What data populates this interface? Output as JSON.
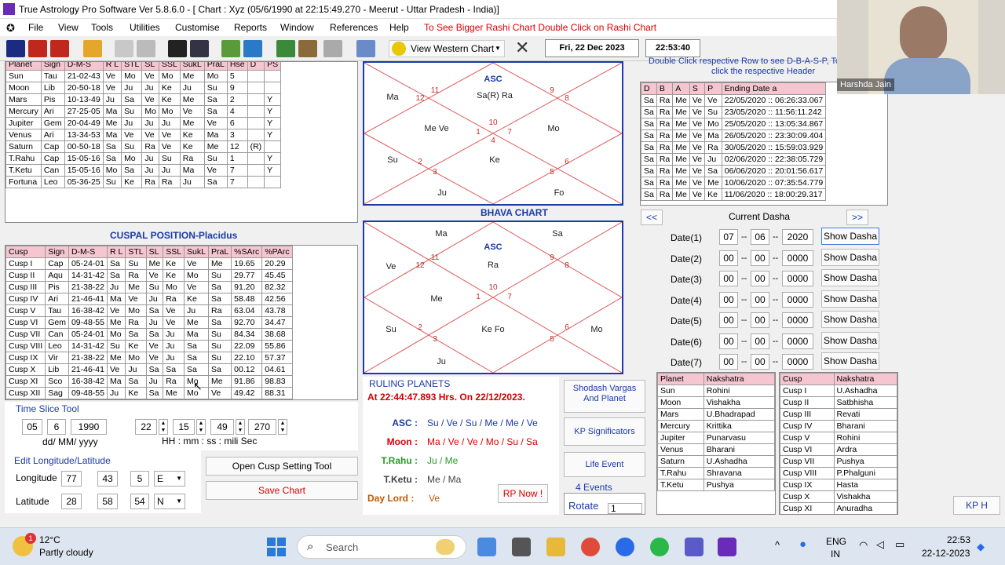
{
  "title_bar": {
    "title": "True Astrology Pro Software Ver 5.8.6.0 - [ Chart : Xyz (05/6/1990 at 22:15:49.270 - Meerut - Uttar Pradesh - India)]"
  },
  "menu": {
    "items": [
      "File",
      "View",
      "Tools",
      "Utilities",
      "Customise",
      "Reports",
      "Window",
      "References",
      "Help"
    ],
    "hint": "To See Bigger Rashi Chart Double Click on Rashi Chart"
  },
  "toolbar": {
    "view_western": "View Western Chart",
    "date": "Fri, 22 Dec 2023",
    "time": "22:53:40"
  },
  "planet_table": {
    "headers": [
      "Planet",
      "Sign",
      "D-M-S",
      "R L",
      "STL",
      "SL",
      "SSL",
      "SukL",
      "PraL",
      "Hse",
      "D",
      "PS"
    ],
    "rows": [
      [
        "Sun",
        "Tau",
        "21-02-43",
        "Ve",
        "Mo",
        "Ve",
        "Mo",
        "Me",
        "Mo",
        "5",
        "",
        ""
      ],
      [
        "Moon",
        "Lib",
        "20-50-18",
        "Ve",
        "Ju",
        "Ju",
        "Ke",
        "Ju",
        "Su",
        "9",
        "",
        ""
      ],
      [
        "Mars",
        "Pis",
        "10-13-49",
        "Ju",
        "Sa",
        "Ve",
        "Ke",
        "Me",
        "Sa",
        "2",
        "",
        "Y"
      ],
      [
        "Mercury",
        "Ari",
        "27-25-05",
        "Ma",
        "Su",
        "Mo",
        "Mo",
        "Ve",
        "Sa",
        "4",
        "",
        "Y"
      ],
      [
        "Jupiter",
        "Gem",
        "20-04-49",
        "Me",
        "Ju",
        "Ju",
        "Ju",
        "Me",
        "Ve",
        "6",
        "",
        "Y"
      ],
      [
        "Venus",
        "Ari",
        "13-34-53",
        "Ma",
        "Ve",
        "Ve",
        "Ve",
        "Ke",
        "Ma",
        "3",
        "",
        "Y"
      ],
      [
        "Saturn",
        "Cap",
        "00-50-18",
        "Sa",
        "Su",
        "Ra",
        "Ve",
        "Ke",
        "Me",
        "12",
        "(R)",
        ""
      ],
      [
        "T.Rahu",
        "Cap",
        "15-05-16",
        "Sa",
        "Mo",
        "Ju",
        "Su",
        "Ra",
        "Su",
        "1",
        "",
        "Y"
      ],
      [
        "T.Ketu",
        "Can",
        "15-05-16",
        "Mo",
        "Sa",
        "Ju",
        "Ju",
        "Ma",
        "Ve",
        "7",
        "",
        "Y"
      ],
      [
        "Fortuna",
        "Leo",
        "05-36-25",
        "Su",
        "Ke",
        "Ra",
        "Ra",
        "Ju",
        "Sa",
        "7",
        "",
        ""
      ]
    ]
  },
  "cuspal": {
    "title": "CUSPAL POSITION-Placidus",
    "headers": [
      "Cusp",
      "Sign",
      "D-M-S",
      "R L",
      "STL",
      "SL",
      "SSL",
      "SukL",
      "PraL",
      "%SArc",
      "%PArc"
    ],
    "rows": [
      [
        "Cusp I",
        "Cap",
        "05-24-01",
        "Sa",
        "Su",
        "Me",
        "Ke",
        "Ve",
        "Me",
        "19.65",
        "20.29"
      ],
      [
        "Cusp II",
        "Aqu",
        "14-31-42",
        "Sa",
        "Ra",
        "Ve",
        "Ke",
        "Mo",
        "Su",
        "29.77",
        "45.45"
      ],
      [
        "Cusp III",
        "Pis",
        "21-38-22",
        "Ju",
        "Me",
        "Su",
        "Mo",
        "Ve",
        "Sa",
        "91.20",
        "82.32"
      ],
      [
        "Cusp IV",
        "Ari",
        "21-46-41",
        "Ma",
        "Ve",
        "Ju",
        "Ra",
        "Ke",
        "Sa",
        "58.48",
        "42.56"
      ],
      [
        "Cusp V",
        "Tau",
        "16-38-42",
        "Ve",
        "Mo",
        "Sa",
        "Ve",
        "Ju",
        "Ra",
        "63.04",
        "43.78"
      ],
      [
        "Cusp VI",
        "Gem",
        "09-48-55",
        "Me",
        "Ra",
        "Ju",
        "Ve",
        "Me",
        "Sa",
        "92.70",
        "34.47"
      ],
      [
        "Cusp VII",
        "Can",
        "05-24-01",
        "Mo",
        "Sa",
        "Sa",
        "Ju",
        "Ma",
        "Su",
        "84.34",
        "38.68"
      ],
      [
        "Cusp VIII",
        "Leo",
        "14-31-42",
        "Su",
        "Ke",
        "Ve",
        "Ju",
        "Sa",
        "Su",
        "22.09",
        "55.86"
      ],
      [
        "Cusp IX",
        "Vir",
        "21-38-22",
        "Me",
        "Mo",
        "Ve",
        "Ju",
        "Sa",
        "Su",
        "22.10",
        "57.37"
      ],
      [
        "Cusp X",
        "Lib",
        "21-46-41",
        "Ve",
        "Ju",
        "Sa",
        "Sa",
        "Sa",
        "Sa",
        "00.12",
        "04.61"
      ],
      [
        "Cusp XI",
        "Sco",
        "16-38-42",
        "Ma",
        "Sa",
        "Ju",
        "Ra",
        "Mo",
        "Me",
        "91.86",
        "98.83"
      ],
      [
        "Cusp XII",
        "Sag",
        "09-48-55",
        "Ju",
        "Ke",
        "Sa",
        "Me",
        "Mo",
        "Ve",
        "49.42",
        "88.31"
      ]
    ]
  },
  "time_slice": {
    "title": "Time Slice Tool",
    "day": "05",
    "month": "6",
    "year": "1990",
    "hh": "22",
    "mm": "15",
    "ss": "49",
    "ms": "270",
    "date_fmt": "dd/ MM/ yyyy",
    "time_fmt": "HH : mm : ss : mili Sec"
  },
  "longlat": {
    "title": "Edit Longitude/Latitude",
    "long_label": "Longitude",
    "long_d": "77",
    "long_m": "43",
    "long_s": "5",
    "long_dir": "E",
    "lat_label": "Latitude",
    "lat_d": "28",
    "lat_m": "58",
    "lat_s": "54",
    "lat_dir": "N"
  },
  "buttons": {
    "open_cusp": "Open Cusp Setting Tool",
    "save_chart": "Save Chart",
    "shodash": "Shodash Vargas And Planet",
    "kp_sig": "KP Significators",
    "life_event": "Life Event",
    "rp_now": "RP Now !",
    "kp": "KP H"
  },
  "rashi_chart": {
    "asc": "ASC",
    "houses": [
      "1",
      "2",
      "3",
      "4",
      "5",
      "6",
      "7",
      "8",
      "9",
      "10",
      "11",
      "12"
    ],
    "planets": {
      "h1": "Sa(R) Ra",
      "h12": "Ma",
      "h2": "Me Ve",
      "h3": "Su",
      "h4": "Ke",
      "h5": "Ju",
      "h6": "Fo",
      "h7": "Mo"
    }
  },
  "bhava_chart": {
    "title": "BHAVA CHART",
    "asc": "ASC",
    "planets": {
      "top_l": "Ma",
      "top_r": "Sa",
      "h1": "Ra",
      "h12": "Ve",
      "h2": "Me",
      "h3": "Su",
      "h4": "Ke Fo",
      "h5": "Ju",
      "h7": "Mo"
    }
  },
  "ruling": {
    "title": "RULING PLANETS",
    "time": "At 22:44:47.893 Hrs. On 22/12/2023.",
    "asc_label": "ASC :",
    "asc_val": "Su / Ve / Su / Me / Me / Ve",
    "moon_label": "Moon :",
    "moon_val": "Ma / Ve / Ve / Mo / Su / Sa",
    "rahu_label": "T.Rahu :",
    "rahu_val": "Ju / Me",
    "ketu_label": "T.Ketu :",
    "ketu_val": "Me / Ma",
    "day_label": "Day Lord :",
    "day_val": "Ve"
  },
  "events": {
    "count": "4 Events",
    "rotate_label": "Rotate",
    "rotate_val": "1"
  },
  "dasha": {
    "hint1": "Double Click respective Row to see D-B-A-S-P, To",
    "hint2": "click the respective Header",
    "headers": [
      "D",
      "B",
      "A",
      "S",
      "P",
      "Ending Date a"
    ],
    "rows": [
      [
        "Sa",
        "Ra",
        "Me",
        "Ve",
        "Ve",
        "22/05/2020 :: 06:26:33.067"
      ],
      [
        "Sa",
        "Ra",
        "Me",
        "Ve",
        "Su",
        "23/05/2020 :: 11:56:11.242"
      ],
      [
        "Sa",
        "Ra",
        "Me",
        "Ve",
        "Mo",
        "25/05/2020 :: 13:05:34.867"
      ],
      [
        "Sa",
        "Ra",
        "Me",
        "Ve",
        "Ma",
        "26/05/2020 :: 23:30:09.404"
      ],
      [
        "Sa",
        "Ra",
        "Me",
        "Ve",
        "Ra",
        "30/05/2020 :: 15:59:03.929"
      ],
      [
        "Sa",
        "Ra",
        "Me",
        "Ve",
        "Ju",
        "02/06/2020 :: 22:38:05.729"
      ],
      [
        "Sa",
        "Ra",
        "Me",
        "Ve",
        "Sa",
        "06/06/2020 :: 20:01:56.617"
      ],
      [
        "Sa",
        "Ra",
        "Me",
        "Ve",
        "Me",
        "10/06/2020 :: 07:35:54.779"
      ],
      [
        "Sa",
        "Ra",
        "Me",
        "Ve",
        "Ke",
        "11/06/2020 :: 18:00:29.317"
      ]
    ],
    "prev": "<<",
    "next": ">>",
    "current": "Current Dasha"
  },
  "date_rows": [
    {
      "label": "Date(1)",
      "d": "07",
      "m": "06",
      "y": "2020",
      "btn": "Show Dasha"
    },
    {
      "label": "Date(2)",
      "d": "00",
      "m": "00",
      "y": "0000",
      "btn": "Show Dasha"
    },
    {
      "label": "Date(3)",
      "d": "00",
      "m": "00",
      "y": "0000",
      "btn": "Show Dasha"
    },
    {
      "label": "Date(4)",
      "d": "00",
      "m": "00",
      "y": "0000",
      "btn": "Show Dasha"
    },
    {
      "label": "Date(5)",
      "d": "00",
      "m": "00",
      "y": "0000",
      "btn": "Show Dasha"
    },
    {
      "label": "Date(6)",
      "d": "00",
      "m": "00",
      "y": "0000",
      "btn": "Show Dasha"
    },
    {
      "label": "Date(7)",
      "d": "00",
      "m": "00",
      "y": "0000",
      "btn": "Show Dasha"
    }
  ],
  "nakshatra_planets": {
    "headers": [
      "Planet",
      "Nakshatra"
    ],
    "rows": [
      [
        "Sun",
        "Rohini"
      ],
      [
        "Moon",
        "Vishakha"
      ],
      [
        "Mars",
        "U.Bhadrapad"
      ],
      [
        "Mercury",
        "Krittika"
      ],
      [
        "Jupiter",
        "Punarvasu"
      ],
      [
        "Venus",
        "Bharani"
      ],
      [
        "Saturn",
        "U.Ashadha"
      ],
      [
        "T.Rahu",
        "Shravana"
      ],
      [
        "T.Ketu",
        "Pushya"
      ]
    ]
  },
  "nakshatra_cusps": {
    "headers": [
      "Cusp",
      "Nakshatra"
    ],
    "rows": [
      [
        "Cusp I",
        "U.Ashadha"
      ],
      [
        "Cusp II",
        "Satbhisha"
      ],
      [
        "Cusp III",
        "Revati"
      ],
      [
        "Cusp IV",
        "Bharani"
      ],
      [
        "Cusp V",
        "Rohini"
      ],
      [
        "Cusp VI",
        "Ardra"
      ],
      [
        "Cusp VII",
        "Pushya"
      ],
      [
        "Cusp VIII",
        "P.Phalguni"
      ],
      [
        "Cusp IX",
        "Hasta"
      ],
      [
        "Cusp X",
        "Vishakha"
      ],
      [
        "Cusp XI",
        "Anuradha"
      ]
    ]
  },
  "webcam": {
    "name": "Harshda Jain"
  },
  "taskbar": {
    "temp": "12°C",
    "weather": "Partly cloudy",
    "badge": "1",
    "search": "Search",
    "lang1": "ENG",
    "lang2": "IN",
    "clock_time": "22:53",
    "clock_date": "22-12-2023"
  },
  "colors": {
    "title_blue": "#1a3aa8",
    "hint_red": "#dd0000",
    "header_pink": "#f6c6d0",
    "chart_line": "#e05a5a"
  }
}
